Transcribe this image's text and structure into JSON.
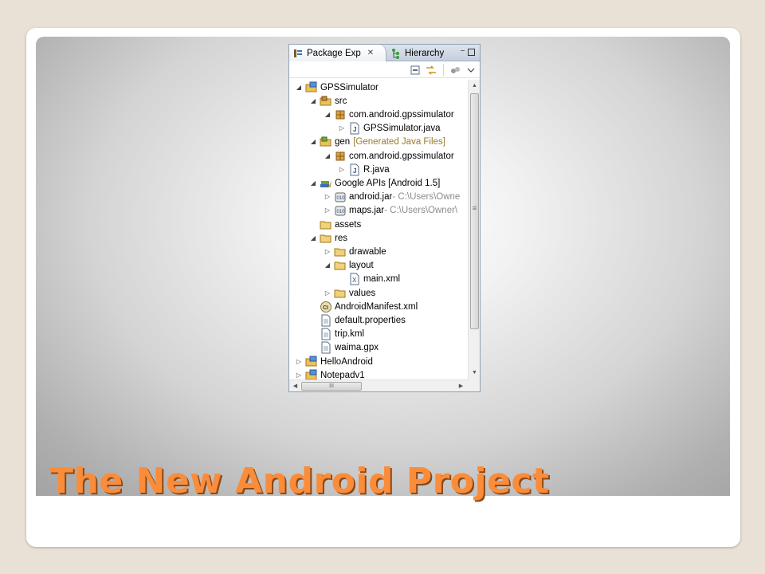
{
  "slide": {
    "title": "The New Android Project"
  },
  "panel": {
    "tabs": [
      {
        "label": "Package Exp",
        "close": "✕",
        "active": true
      },
      {
        "label": "Hierarchy",
        "active": false
      }
    ],
    "window_buttons": {
      "minimize": "−",
      "maximize": "□"
    }
  },
  "tree": [
    {
      "indent": 0,
      "twisty": "◢",
      "icon": "project-icon",
      "label": "GPSSimulator",
      "dec": ""
    },
    {
      "indent": 1,
      "twisty": "◢",
      "icon": "source-folder-icon",
      "label": "src",
      "dec": ""
    },
    {
      "indent": 2,
      "twisty": "◢",
      "icon": "package-icon",
      "label": "com.android.gpssimulator",
      "dec": ""
    },
    {
      "indent": 3,
      "twisty": "▷",
      "icon": "java-file-icon",
      "label": "GPSSimulator.java",
      "dec": ""
    },
    {
      "indent": 1,
      "twisty": "◢",
      "icon": "gen-folder-icon",
      "label": "gen",
      "dec": "[Generated Java Files]",
      "dec_style": "olive"
    },
    {
      "indent": 2,
      "twisty": "◢",
      "icon": "package-icon",
      "label": "com.android.gpssimulator",
      "dec": ""
    },
    {
      "indent": 3,
      "twisty": "▷",
      "icon": "java-file-icon",
      "label": "R.java",
      "dec": ""
    },
    {
      "indent": 1,
      "twisty": "◢",
      "icon": "library-icon",
      "label": "Google APIs [Android 1.5]",
      "dec": ""
    },
    {
      "indent": 2,
      "twisty": "▷",
      "icon": "jar-icon",
      "label": "android.jar",
      "dec": " - C:\\Users\\Owne"
    },
    {
      "indent": 2,
      "twisty": "▷",
      "icon": "jar-icon",
      "label": "maps.jar",
      "dec": " - C:\\Users\\Owner\\"
    },
    {
      "indent": 1,
      "twisty": "",
      "icon": "folder-icon",
      "label": "assets",
      "dec": ""
    },
    {
      "indent": 1,
      "twisty": "◢",
      "icon": "folder-icon",
      "label": "res",
      "dec": ""
    },
    {
      "indent": 2,
      "twisty": "▷",
      "icon": "folder-icon",
      "label": "drawable",
      "dec": ""
    },
    {
      "indent": 2,
      "twisty": "◢",
      "icon": "folder-icon",
      "label": "layout",
      "dec": ""
    },
    {
      "indent": 3,
      "twisty": "",
      "icon": "xml-file-icon",
      "label": "main.xml",
      "dec": ""
    },
    {
      "indent": 2,
      "twisty": "▷",
      "icon": "folder-icon",
      "label": "values",
      "dec": ""
    },
    {
      "indent": 1,
      "twisty": "",
      "icon": "manifest-icon",
      "label": "AndroidManifest.xml",
      "dec": ""
    },
    {
      "indent": 1,
      "twisty": "",
      "icon": "text-file-icon",
      "label": "default.properties",
      "dec": ""
    },
    {
      "indent": 1,
      "twisty": "",
      "icon": "text-file-icon",
      "label": "trip.kml",
      "dec": ""
    },
    {
      "indent": 1,
      "twisty": "",
      "icon": "text-file-icon",
      "label": "waima.gpx",
      "dec": ""
    },
    {
      "indent": 0,
      "twisty": "▷",
      "icon": "project-icon",
      "label": "HelloAndroid",
      "dec": ""
    },
    {
      "indent": 0,
      "twisty": "▷",
      "icon": "project-icon",
      "label": "Notepadv1",
      "dec": ""
    }
  ],
  "scrollbars": {
    "up": "▲",
    "down": "▼",
    "left": "◀",
    "right": "▶",
    "grip": "≡",
    "hgrip": "III"
  },
  "colors": {
    "title": "#fa8c3a",
    "title_shadow": "#8a4a18",
    "panel_border": "#8da0b6"
  }
}
